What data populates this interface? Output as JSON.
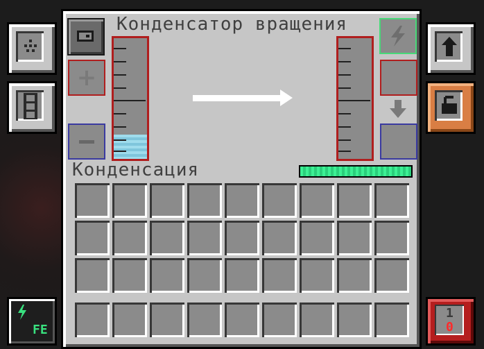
{
  "gui": {
    "title": "Конденсатор вращения",
    "mode_label": "Конденсация"
  },
  "input_tank": {
    "fill": 0.2,
    "fluid_color": "#8ad1e6"
  },
  "output_tank": {
    "fill": 0.0
  },
  "progress": {
    "value": 1.0,
    "color": "#34e089"
  },
  "energy_unit": {
    "label": "FE"
  },
  "redstone": {
    "top": "1",
    "bottom": "0"
  },
  "icons": {
    "side_config": "dots-grid-icon",
    "transporter": "film-strip-icon",
    "upgrade": "up-arrow-icon",
    "security": "padlock-icon",
    "energy": "lightning-icon",
    "bucket_slot": "bucket-icon",
    "down_arrow": "down-arrow-icon"
  },
  "colors": {
    "panel": "#c6c6c6",
    "slot": "#8b8b8b",
    "input_frame": "#b01e1e",
    "output_frame": "#3a3aa0",
    "energy_frame": "#47d978",
    "security_tab": "#d97e44",
    "redstone_tab": "#b51e1e"
  }
}
